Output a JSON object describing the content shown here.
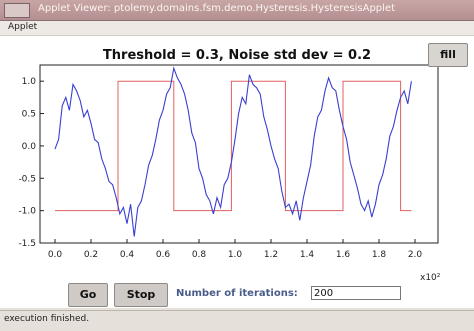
{
  "window": {
    "title": "Applet Viewer: ptolemy.domains.fsm.demo.Hysteresis.HysteresisApplet"
  },
  "menubar": {
    "menu": "Applet"
  },
  "plot": {
    "heading": "Threshold = 0.3, Noise std dev = 0.2",
    "x_multiplier": "x10²"
  },
  "fill_button": {
    "label": "fill"
  },
  "controls": {
    "go_label": "Go",
    "stop_label": "Stop",
    "iterations_label": "Number of iterations:",
    "iterations_value": "200"
  },
  "status": {
    "text": "execution finished."
  },
  "colors": {
    "signal": "#3a3fd0",
    "output": "#e06060"
  },
  "chart_data": {
    "type": "line",
    "title": "Threshold = 0.3, Noise std dev = 0.2",
    "xlim": [
      0,
      2.0
    ],
    "ylim": [
      -1.5,
      1.25
    ],
    "x_ticks": [
      0.0,
      0.2,
      0.4,
      0.6,
      0.8,
      1.0,
      1.2,
      1.4,
      1.6,
      1.8,
      2.0
    ],
    "y_ticks": [
      1.0,
      0.5,
      0.0,
      -0.5,
      -1.0,
      -1.5
    ],
    "grid": false,
    "series": [
      {
        "color": "#e06060",
        "x": [
          0.0,
          0.35,
          0.35,
          0.66,
          0.66,
          0.98,
          0.98,
          1.28,
          1.28,
          1.6,
          1.6,
          1.92,
          1.92,
          1.98
        ],
        "values": [
          -1.0,
          -1.0,
          1.0,
          1.0,
          -1.0,
          -1.0,
          1.0,
          1.0,
          -1.0,
          -1.0,
          1.0,
          1.0,
          -1.0,
          -1.0
        ]
      },
      {
        "color": "#3a3fd0",
        "x": [
          0.0,
          0.02,
          0.04,
          0.06,
          0.08,
          0.1,
          0.12,
          0.14,
          0.16,
          0.18,
          0.2,
          0.22,
          0.24,
          0.26,
          0.28,
          0.3,
          0.32,
          0.34,
          0.36,
          0.38,
          0.4,
          0.42,
          0.44,
          0.46,
          0.48,
          0.5,
          0.52,
          0.54,
          0.56,
          0.58,
          0.6,
          0.62,
          0.64,
          0.66,
          0.68,
          0.7,
          0.72,
          0.74,
          0.76,
          0.78,
          0.8,
          0.82,
          0.84,
          0.86,
          0.88,
          0.9,
          0.92,
          0.94,
          0.96,
          0.98,
          1.0,
          1.02,
          1.04,
          1.06,
          1.08,
          1.1,
          1.12,
          1.14,
          1.16,
          1.18,
          1.2,
          1.22,
          1.24,
          1.26,
          1.28,
          1.3,
          1.32,
          1.34,
          1.36,
          1.38,
          1.4,
          1.42,
          1.44,
          1.46,
          1.48,
          1.5,
          1.52,
          1.54,
          1.56,
          1.58,
          1.6,
          1.62,
          1.64,
          1.66,
          1.68,
          1.7,
          1.72,
          1.74,
          1.76,
          1.78,
          1.8,
          1.82,
          1.84,
          1.86,
          1.88,
          1.9,
          1.92,
          1.94,
          1.96,
          1.98
        ],
        "values": [
          -0.05,
          0.1,
          0.62,
          0.75,
          0.55,
          0.95,
          0.85,
          0.7,
          0.45,
          0.55,
          0.35,
          0.1,
          0.05,
          -0.2,
          -0.35,
          -0.55,
          -0.6,
          -0.8,
          -1.05,
          -0.95,
          -1.2,
          -0.9,
          -1.4,
          -0.95,
          -0.85,
          -0.6,
          -0.3,
          -0.15,
          0.1,
          0.4,
          0.55,
          0.8,
          0.9,
          1.2,
          1.05,
          0.95,
          0.8,
          0.55,
          0.2,
          0.05,
          -0.35,
          -0.5,
          -0.75,
          -0.85,
          -1.05,
          -0.8,
          -0.95,
          -0.6,
          -0.5,
          -0.25,
          0.1,
          0.5,
          0.75,
          0.65,
          1.1,
          0.95,
          0.9,
          0.8,
          0.45,
          0.25,
          0.0,
          -0.2,
          -0.35,
          -0.7,
          -0.95,
          -0.9,
          -1.05,
          -0.85,
          -1.15,
          -0.8,
          -0.55,
          -0.3,
          0.15,
          0.45,
          0.55,
          0.85,
          1.05,
          0.9,
          0.85,
          0.55,
          0.3,
          0.1,
          -0.25,
          -0.45,
          -0.65,
          -0.9,
          -1.0,
          -0.85,
          -1.1,
          -0.9,
          -0.6,
          -0.45,
          -0.2,
          0.15,
          0.3,
          0.55,
          0.75,
          0.85,
          0.65,
          1.0
        ]
      }
    ]
  }
}
